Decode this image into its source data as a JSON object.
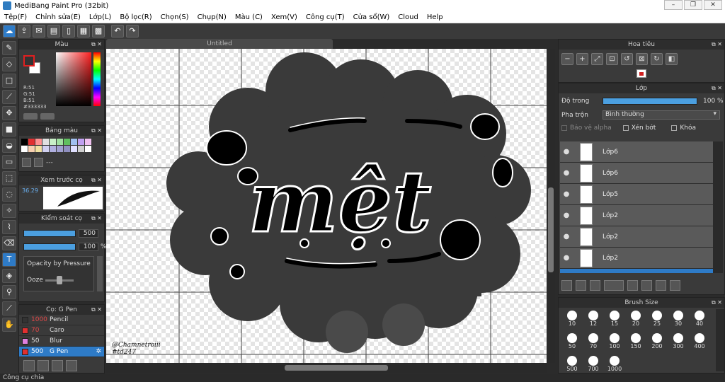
{
  "window": {
    "title": "MediBang Paint Pro (32bit)",
    "minimize": "–",
    "maximize": "❐",
    "close": "✕"
  },
  "menu": [
    "Tệp(F)",
    "Chỉnh sửa(E)",
    "Lớp(L)",
    "Bộ lọc(R)",
    "Chọn(S)",
    "Chụp(N)",
    "Màu (C)",
    "Xem(V)",
    "Công cụ(T)",
    "Cửa sổ(W)",
    "Cloud",
    "Help"
  ],
  "color_panel": {
    "title": "Màu",
    "r": "R:51",
    "g": "G:51",
    "b": "B:51",
    "hex": "#333333",
    "fg_color": "#333333",
    "bg_color": "#ffffff"
  },
  "palette_panel": {
    "title": "Bảng màu",
    "dash": "---",
    "swatches": [
      "#000000",
      "#e03030",
      "#ff9090",
      "#e0e0e0",
      "#c8f0c8",
      "#a0e0a0",
      "#60c060",
      "#a0c0f0",
      "#c0a0f0",
      "#f0c0f0",
      "#ffffff",
      "#f8d0b0",
      "#f0e0a0",
      "#d0d0f0",
      "#b0b0e0",
      "#a0a0d0",
      "#9090c0",
      "#e0e0ff",
      "#d0d0d0",
      "#ffffff"
    ]
  },
  "preview_panel": {
    "title": "Xem trước cọ",
    "percent": "36.29"
  },
  "control_panel": {
    "title": "Kiểm soát cọ",
    "size_value": "500",
    "opacity_value": "100",
    "opacity_unit": "%",
    "opacity_by_pressure": "Opacity by Pressure",
    "ooze": "Ooze"
  },
  "brush_panel": {
    "title": "Cọ: G Pen",
    "brushes": [
      {
        "size": "1000",
        "name": "Pencil",
        "color": "#333333"
      },
      {
        "size": "70",
        "name": "Caro",
        "color": "#e03030"
      },
      {
        "size": "50",
        "name": "Blur",
        "color": "#e080e0"
      },
      {
        "size": "500",
        "name": "G Pen",
        "color": "#e03030"
      }
    ]
  },
  "document": {
    "tab": "Untitled",
    "watermark_line1": "@Chamnetroiii",
    "watermark_line2": "#td247",
    "lettering": "mệt"
  },
  "navigator_panel": {
    "title": "Hoa tiêu"
  },
  "layer_panel": {
    "title": "Lớp",
    "opacity_label": "Độ trong",
    "opacity_value": "100 %",
    "blend_label": "Pha trộn",
    "blend_value": "Bình thường",
    "protect_alpha": "Bảo vệ alpha",
    "clipping": "Xén bớt",
    "lock": "Khóa",
    "layers": [
      "Lớp6",
      "Lớp6",
      "Lớp5",
      "Lớp2",
      "Lớp2",
      "Lớp2"
    ]
  },
  "size_panel": {
    "title": "Brush Size",
    "sizes": [
      "10",
      "12",
      "15",
      "20",
      "25",
      "30",
      "40",
      "50",
      "70",
      "100",
      "150",
      "200",
      "300",
      "400",
      "500",
      "700",
      "1000"
    ]
  },
  "status": {
    "text": "Công cụ chia"
  }
}
